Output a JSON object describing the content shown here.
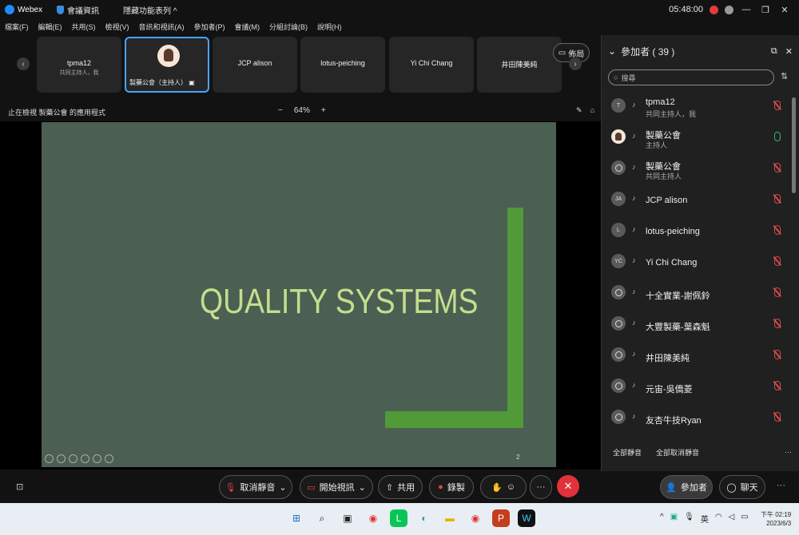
{
  "titlebar": {
    "app_name": "Webex",
    "meeting_info": "會議資訊",
    "hidden_features": "隱藏功能表列 ^",
    "timer": "05:48:00",
    "colors": {
      "accent": "#1f8cff",
      "record": "#e23b3b"
    }
  },
  "menu": [
    "檔案(F)",
    "編輯(E)",
    "共用(S)",
    "檢視(V)",
    "音訊和視訊(A)",
    "參加者(P)",
    "會議(M)",
    "分組討論(B)",
    "說明(H)"
  ],
  "tiles": [
    {
      "name": "tpma12",
      "sub": "共同主持人，我"
    },
    {
      "name": "製藥公會（主持人）"
    },
    {
      "name": "JCP alison"
    },
    {
      "name": "lotus-peiching"
    },
    {
      "name": "Yi Chi Chang"
    },
    {
      "name": "井田陳美純"
    }
  ],
  "layout_label": "佈局",
  "share": {
    "status": "止在檢視 製藥公會 的應用程式",
    "zoom_minus": "−",
    "zoom": "64%",
    "zoom_plus": "+"
  },
  "slide": {
    "title": "QUALITY SYSTEMS",
    "page": "2",
    "bg_color": "#4b5f53",
    "accent_color": "#519a38",
    "title_color": "#c4de8c"
  },
  "panel": {
    "title": "參加者 ( 39 )",
    "search_placeholder": "搜尋",
    "participants": [
      {
        "avatar": "T",
        "name": "tpma12",
        "role": "共同主持人，我",
        "mic": "muted"
      },
      {
        "avatar": "",
        "name": "製藥公會",
        "role": "主持人",
        "mic": "on"
      },
      {
        "avatar": "",
        "name": "製藥公會",
        "role": "共同主持人",
        "mic": "muted"
      },
      {
        "avatar": "JA",
        "name": "JCP alison",
        "role": "",
        "mic": "muted"
      },
      {
        "avatar": "L",
        "name": "lotus-peiching",
        "role": "",
        "mic": "muted"
      },
      {
        "avatar": "YC",
        "name": "Yi Chi Chang",
        "role": "",
        "mic": "muted"
      },
      {
        "avatar": "",
        "name": "十全實業-謝佩鈴",
        "role": "",
        "mic": "muted"
      },
      {
        "avatar": "",
        "name": "大豐製藥-葉森魁",
        "role": "",
        "mic": "muted"
      },
      {
        "avatar": "",
        "name": "井田陳美純",
        "role": "",
        "mic": "muted"
      },
      {
        "avatar": "",
        "name": "元宙-吳僑菱",
        "role": "",
        "mic": "muted"
      },
      {
        "avatar": "",
        "name": "友杏牛技Ryan",
        "role": "",
        "mic": "muted"
      }
    ],
    "mute_all": "全部靜音",
    "unmute_all": "全部取消靜音"
  },
  "controls": {
    "unmute": "取消靜音",
    "start_video": "開始視訊",
    "share": "共用",
    "record": "錄製",
    "participants": "參加者",
    "chat": "聊天"
  },
  "taskbar": {
    "ime": "英",
    "time": "下午 02:19",
    "date": "2023/6/3"
  }
}
